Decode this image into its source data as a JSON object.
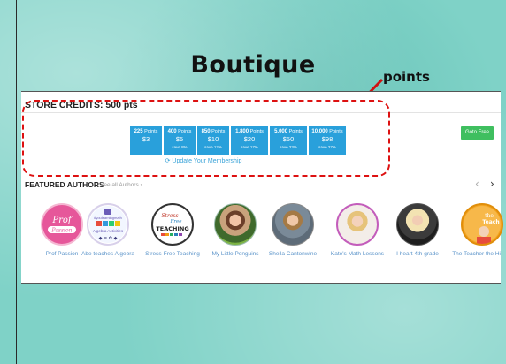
{
  "slide": {
    "title": "Boutique",
    "annotation": "points"
  },
  "store": {
    "credits_label": "STORE CREDITS: 500 pts",
    "packages": [
      {
        "points": "225",
        "unit": "Points",
        "price": "$3",
        "save": ""
      },
      {
        "points": "400",
        "unit": "Points",
        "price": "$5",
        "save": "save 8%"
      },
      {
        "points": "850",
        "unit": "Points",
        "price": "$10",
        "save": "save 12%"
      },
      {
        "points": "1,800",
        "unit": "Points",
        "price": "$20",
        "save": "save 17%"
      },
      {
        "points": "5,000",
        "unit": "Points",
        "price": "$50",
        "save": "save 23%"
      },
      {
        "points": "10,000",
        "unit": "Points",
        "price": "$98",
        "save": "save 27%"
      }
    ],
    "update_link": "Update Your Membership",
    "goto_button": "Goto Free"
  },
  "featured": {
    "title": "FEATURED AUTHORS",
    "see_all": "See all Authors ›",
    "prev": "‹",
    "next": "›",
    "authors": [
      {
        "name": "Prof Passion",
        "avatar_text": "Prof Passion"
      },
      {
        "name": "Abe teaches Algebra",
        "avatar_text": "#youlearningmath Algebra Activities"
      },
      {
        "name": "Stress-Free Teaching",
        "avatar_text": "Stress Free TEACHING"
      },
      {
        "name": "My Little Penguins",
        "avatar_text": ""
      },
      {
        "name": "Sheila Cantonwine",
        "avatar_text": ""
      },
      {
        "name": "Kate's Math Lessons",
        "avatar_text": ""
      },
      {
        "name": "I heart 4th grade",
        "avatar_text": ""
      },
      {
        "name": "The Teacher the Hi",
        "avatar_text": "the Teach"
      }
    ]
  },
  "colors": {
    "background": "#7fd2c7",
    "package_blue": "#29a0db",
    "goto_green": "#3fbf5f",
    "highlight_red": "#d11111",
    "link_blue": "#5a93c9"
  }
}
